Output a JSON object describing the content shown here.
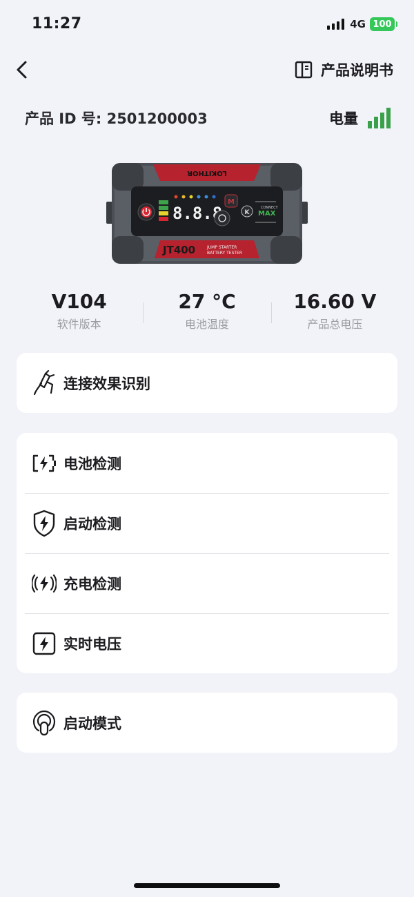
{
  "status_bar": {
    "time": "11:27",
    "network": "4G",
    "battery": "100"
  },
  "header": {
    "manual_label": "产品说明书"
  },
  "info": {
    "product_id": "产品 ID 号: 2501200003",
    "power_label": "电量",
    "power_color": "#3aa14a"
  },
  "device": {
    "brand_text": "LOKITHOR",
    "model": "JT400",
    "tagline_1": "JUMP STARTER",
    "tagline_2": "BATTERY TESTER",
    "badge_top": "CONNECT",
    "badge_main": "MAX",
    "display": "8.8.8",
    "m_button": "M"
  },
  "stats": [
    {
      "value": "V104",
      "label": "软件版本"
    },
    {
      "value": "27 °C",
      "label": "电池温度"
    },
    {
      "value": "16.60 V",
      "label": "产品总电压"
    }
  ],
  "menu": {
    "connection": {
      "label": "连接效果识别",
      "icon": "clamp-icon"
    },
    "tests": [
      {
        "label": "电池检测",
        "icon": "battery-bolt-icon"
      },
      {
        "label": "启动检测",
        "icon": "shield-bolt-icon"
      },
      {
        "label": "充电检测",
        "icon": "wireless-bolt-icon"
      },
      {
        "label": "实时电压",
        "icon": "square-bolt-icon"
      }
    ],
    "mode": {
      "label": "启动模式",
      "icon": "start-mode-icon"
    }
  }
}
